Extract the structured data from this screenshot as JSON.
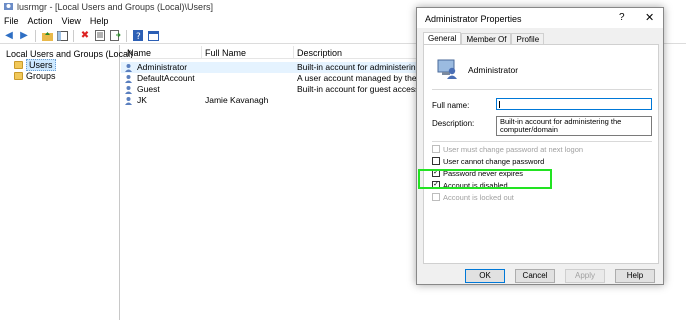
{
  "window": {
    "title": "lusrmgr - [Local Users and Groups (Local)\\Users]"
  },
  "menu": [
    "File",
    "Action",
    "View",
    "Help"
  ],
  "toolbar": {
    "icons": [
      "back-arrow-icon",
      "forward-arrow-icon",
      "up-folder-icon",
      "show-hide-tree-icon",
      "delete-icon",
      "properties-icon",
      "export-list-icon",
      "help-icon",
      "console-icon"
    ]
  },
  "tree": {
    "root": "Local Users and Groups (Local)",
    "children": [
      "Users",
      "Groups"
    ]
  },
  "list": {
    "columns": [
      "Name",
      "Full Name",
      "Description"
    ],
    "rows": [
      {
        "name": "Administrator",
        "full_name": "",
        "description": "Built-in account for administering th"
      },
      {
        "name": "DefaultAccount",
        "full_name": "",
        "description": "A user account managed by the syste"
      },
      {
        "name": "Guest",
        "full_name": "",
        "description": "Built-in account for guest access to t"
      },
      {
        "name": "JK",
        "full_name": "Jamie Kavanagh",
        "description": ""
      }
    ]
  },
  "dialog": {
    "title": "Administrator Properties",
    "help": "?",
    "close": "✕",
    "tabs": [
      "General",
      "Member Of",
      "Profile"
    ],
    "user_name": "Administrator",
    "full_name_label": "Full name:",
    "full_name_value": "",
    "description_label": "Description:",
    "description_value": "Built-in account for administering the computer/domain",
    "checkboxes": [
      {
        "label": "User must change password at next logon",
        "checked": false,
        "disabled": true
      },
      {
        "label": "User cannot change password",
        "checked": false,
        "disabled": false
      },
      {
        "label": "Password never expires",
        "checked": true,
        "disabled": false
      },
      {
        "label": "Account is disabled",
        "checked": true,
        "disabled": false
      },
      {
        "label": "Account is locked out",
        "checked": false,
        "disabled": true
      }
    ],
    "buttons": {
      "ok": "OK",
      "cancel": "Cancel",
      "apply": "Apply",
      "help": "Help"
    }
  },
  "colors": {
    "highlight": "#22e322",
    "selection": "#cce8ff",
    "focus": "#0078d7"
  }
}
